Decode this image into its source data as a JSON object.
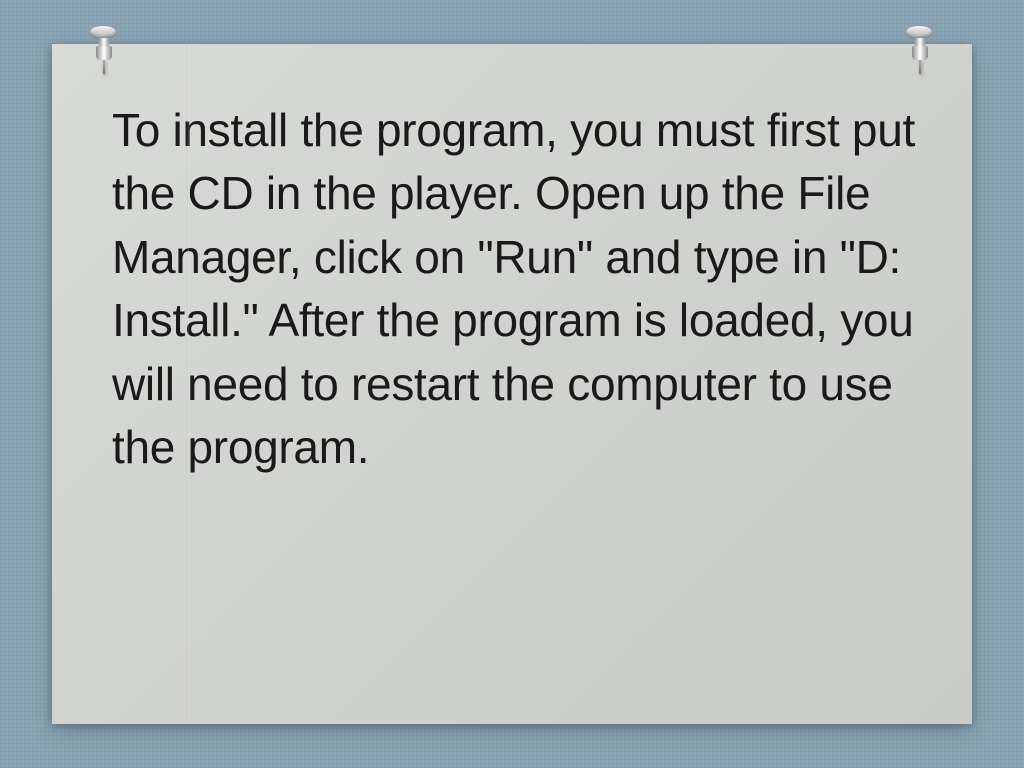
{
  "note": {
    "body_text": "To install the program, you must first put the CD in the player. Open up the File Manager, click on \"Run\" and type in \"D: Install.\" After the program is loaded, you will need to restart the computer to use the program."
  }
}
